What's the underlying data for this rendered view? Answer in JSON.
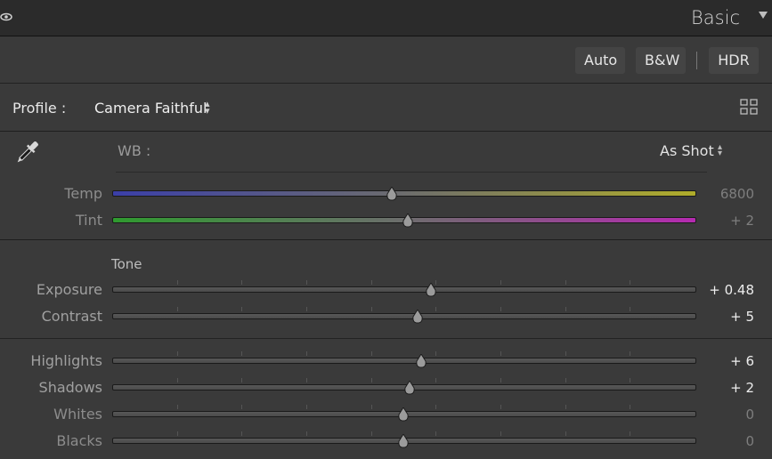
{
  "header": {
    "title": "Basic"
  },
  "auto_buttons": {
    "auto": "Auto",
    "bw": "B&W",
    "hdr": "HDR"
  },
  "profile": {
    "label": "Profile :",
    "value": "Camera Faithful"
  },
  "wb": {
    "label": "WB :",
    "value": "As Shot"
  },
  "sliders": {
    "temp": {
      "label": "Temp",
      "value": "6800",
      "position": 0.48
    },
    "tint": {
      "label": "Tint",
      "value": "+ 2",
      "position": 0.508
    },
    "exposure": {
      "label": "Exposure",
      "value": "+ 0.48",
      "position": 0.548
    },
    "contrast": {
      "label": "Contrast",
      "value": "+ 5",
      "position": 0.525
    },
    "highlights": {
      "label": "Highlights",
      "value": "+ 6",
      "position": 0.53
    },
    "shadows": {
      "label": "Shadows",
      "value": "+ 2",
      "position": 0.51
    },
    "whites": {
      "label": "Whites",
      "value": "0",
      "position": 0.5
    },
    "blacks": {
      "label": "Blacks",
      "value": "0",
      "position": 0.5
    }
  },
  "tone": {
    "title": "Tone"
  },
  "icons": {
    "eye": "eye-icon",
    "collapse": "triangle-down-icon",
    "grid": "grid-icon",
    "eyedropper": "eyedropper-icon",
    "up_down": "up-down-arrows-icon"
  },
  "colors": {
    "background": "#3a3a3a",
    "header": "#2b2b2b",
    "temp_left": "#3b3fa8",
    "temp_right": "#b0ad2a",
    "tint_left": "#2f9a2f",
    "tint_right": "#b52ab0"
  }
}
